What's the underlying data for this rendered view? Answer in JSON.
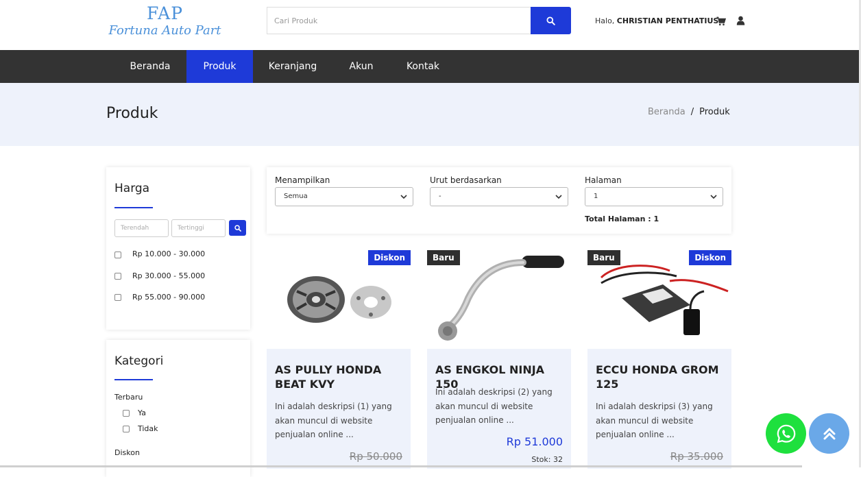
{
  "brand": {
    "name": "FAP",
    "tagline": "Fortuna Auto Part",
    "color": "#4a90d9"
  },
  "header": {
    "search_placeholder": "Cari Produk",
    "greeting_prefix": "Halo,",
    "user_name": "CHRISTIAN PENTHATIUS"
  },
  "nav": {
    "items": [
      {
        "label": "Beranda",
        "active": false
      },
      {
        "label": "Produk",
        "active": true
      },
      {
        "label": "Keranjang",
        "active": false
      },
      {
        "label": "Akun",
        "active": false
      },
      {
        "label": "Kontak",
        "active": false
      }
    ]
  },
  "page": {
    "title": "Produk",
    "breadcrumb": [
      "Beranda",
      "/",
      "Produk"
    ]
  },
  "sidebar": {
    "price": {
      "title": "Harga",
      "min_placeholder": "Terendah",
      "max_placeholder": "Tertinggi",
      "ranges": [
        "Rp 10.000 - 30.000",
        "Rp 30.000 - 55.000",
        "Rp 55.000 - 90.000"
      ]
    },
    "category": {
      "title": "Kategori",
      "newest_label": "Terbaru",
      "newest_options": [
        "Ya",
        "Tidak"
      ],
      "discount_label": "Diskon"
    }
  },
  "filters": {
    "show": {
      "label": "Menampilkan",
      "value": "Semua"
    },
    "sort": {
      "label": "Urut berdasarkan",
      "value": "-"
    },
    "page": {
      "label": "Halaman",
      "value": "1"
    },
    "total_pages": "Total Halaman : 1"
  },
  "products": [
    {
      "name": "AS PULLY HONDA BEAT KVY",
      "description": "Ini adalah deskripsi (1) yang akan muncul di website penjualan online ...",
      "badges": [
        "Diskon"
      ],
      "old_price": "Rp 50.000"
    },
    {
      "name": "AS ENGKOL NINJA 150",
      "description": "Ini adalah deskripsi (2) yang akan muncul di website penjualan online ...",
      "badges": [
        "Baru"
      ],
      "price": "Rp 51.000",
      "stock": "Stok: 32"
    },
    {
      "name": "ECCU HONDA GROM 125",
      "description": "Ini adalah deskripsi (3) yang akan muncul di website penjualan online ...",
      "badges": [
        "Baru",
        "Diskon"
      ],
      "old_price": "Rp 35.000"
    }
  ],
  "colors": {
    "primary": "#1e3ad8",
    "nav_bg": "#333333",
    "banner_bg": "#eef2fb",
    "whatsapp": "#1ee03e",
    "to_top": "#6aa8e8"
  }
}
